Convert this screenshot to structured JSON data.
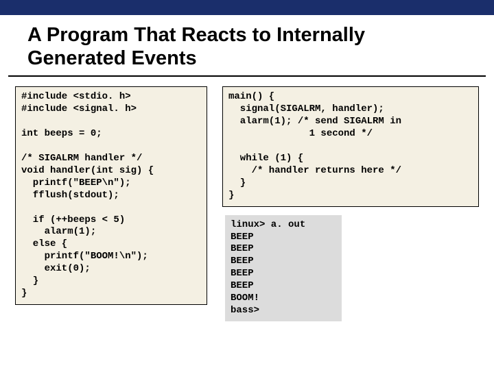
{
  "slide": {
    "title": "A Program That Reacts to Internally Generated Events"
  },
  "code": {
    "left": "#include <stdio. h>\n#include <signal. h>\n\nint beeps = 0;\n\n/* SIGALRM handler */\nvoid handler(int sig) {\n  printf(\"BEEP\\n\");\n  fflush(stdout);\n\n  if (++beeps < 5)\n    alarm(1);\n  else {\n    printf(\"BOOM!\\n\");\n    exit(0);\n  }\n}",
    "right_top": "main() {\n  signal(SIGALRM, handler);\n  alarm(1); /* send SIGALRM in\n              1 second */\n\n  while (1) {\n    /* handler returns here */\n  }\n}",
    "terminal": "linux> a. out\nBEEP\nBEEP\nBEEP\nBEEP\nBEEP\nBOOM!\nbass>"
  }
}
